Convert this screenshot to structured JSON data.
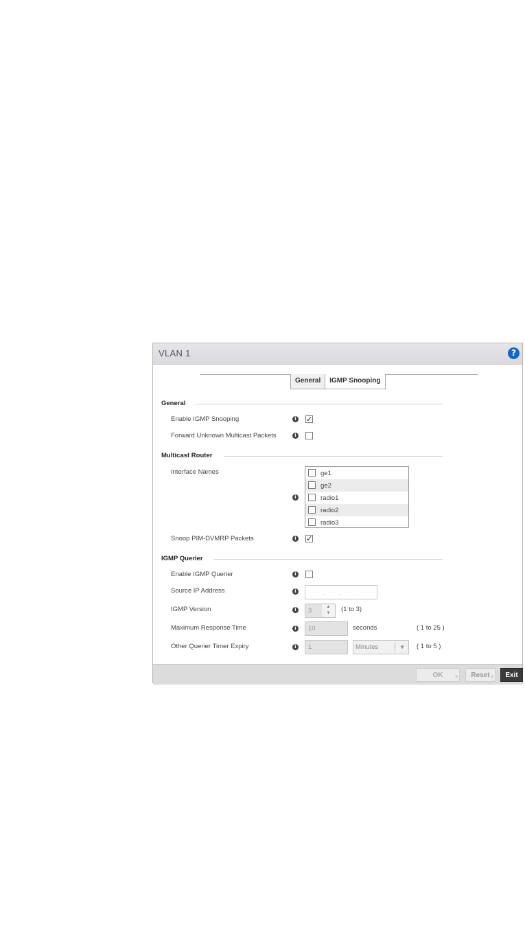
{
  "window": {
    "title": "VLAN   1",
    "help_icon": "help-icon",
    "help_glyph": "?"
  },
  "tabs": [
    {
      "label": "General",
      "active": true
    },
    {
      "label": "IGMP Snooping",
      "active": false
    }
  ],
  "sections": {
    "general": "General",
    "multicast_router": "Multicast Router",
    "igmp_querier": "IGMP Querier"
  },
  "general": {
    "enable_igmp_snooping": {
      "label": "Enable IGMP Snooping",
      "checked": true
    },
    "forward_unknown": {
      "label": "Forward Unknown Multicast Packets",
      "checked": false
    }
  },
  "multicast_router": {
    "interface_names_label": "Interface Names",
    "interfaces": [
      {
        "label": "ge1",
        "checked": false
      },
      {
        "label": "ge2",
        "checked": false
      },
      {
        "label": "radio1",
        "checked": false
      },
      {
        "label": "radio2",
        "checked": false
      },
      {
        "label": "radio3",
        "checked": false
      }
    ],
    "snoop_pim_dvmrp": {
      "label": "Snoop PIM-DVMRP Packets",
      "checked": true
    }
  },
  "igmp_querier": {
    "enable_igmp_querier": {
      "label": "Enable IGMP Querier",
      "checked": false
    },
    "source_ip": {
      "label": "Source IP Address",
      "value": ""
    },
    "igmp_version": {
      "label": "IGMP Version",
      "value": "3",
      "range": "(1 to 3)"
    },
    "max_response_time": {
      "label": "Maximum Response Time",
      "value": "10",
      "unit": "seconds",
      "range": "( 1 to 25 )"
    },
    "other_querier_timer": {
      "label": "Other Querier Timer Expiry",
      "value": "1",
      "unit": "Minutes",
      "range": "( 1 to 5 )"
    }
  },
  "footer": {
    "ok_label": "OK",
    "reset_label": "Reset",
    "exit_label": "Exit"
  },
  "icons": {
    "info_glyph": "i",
    "check_glyph": "✓",
    "spin_up": "▲",
    "spin_down": "▼",
    "dropdown_arrow": "▼"
  }
}
